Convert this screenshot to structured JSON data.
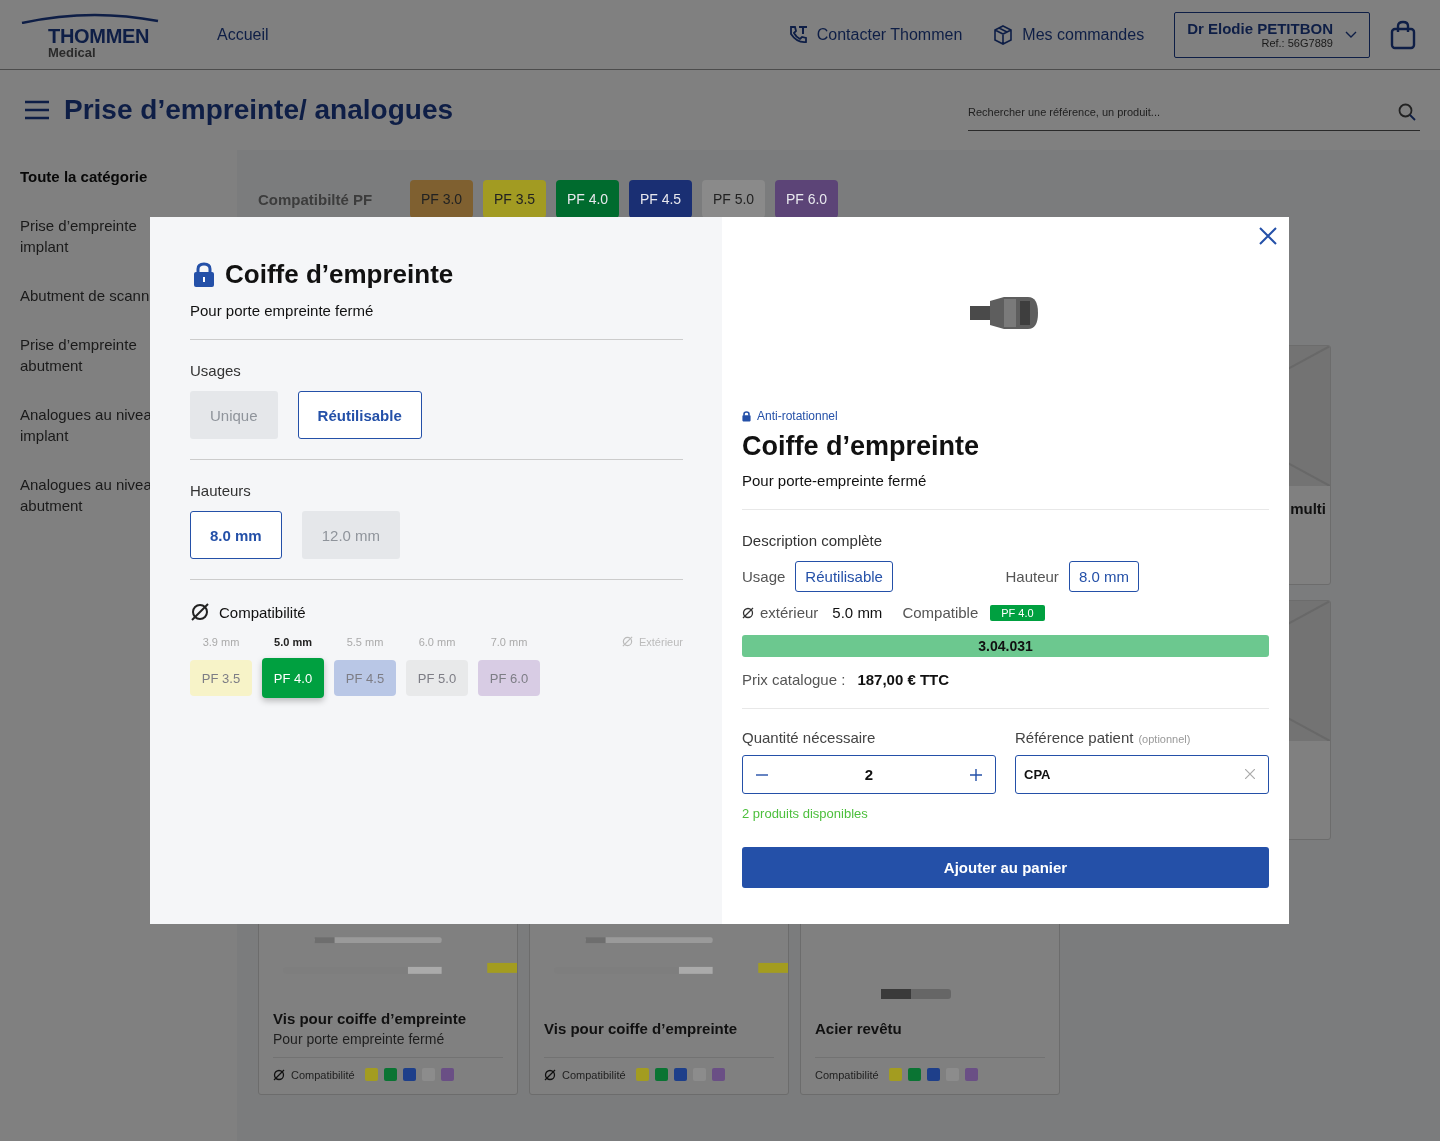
{
  "header": {
    "logo": {
      "name": "THOMMEN",
      "sub": "Medical"
    },
    "nav": [
      "Accueil"
    ],
    "actions": [
      {
        "kind": "phone",
        "label": "Contacter Thommen"
      },
      {
        "kind": "box",
        "label": "Mes commandes"
      }
    ],
    "user": {
      "name": "Dr Elodie PETITBON",
      "ref": "Ref.: 56G7889"
    }
  },
  "page_title": "Prise d’empreinte/ analogues",
  "search": {
    "placeholder": "Rechercher une référence, un produit..."
  },
  "sidebar": {
    "items": [
      {
        "label": "Toute la catégorie",
        "selected": true
      },
      {
        "label": "Prise d’empreinte\nimplant",
        "selected": false
      },
      {
        "label": "Abutment de scann",
        "selected": false
      },
      {
        "label": "Prise d’empreinte\nabutment",
        "selected": false
      },
      {
        "label": "Analogues au nivea\nimplant",
        "selected": false
      },
      {
        "label": "Analogues au nivea\nabutment",
        "selected": false
      }
    ]
  },
  "filter": {
    "label": "Compatibilté PF",
    "chips": [
      {
        "label": "PF 3.0",
        "color": "#7f6030",
        "dark_text": true
      },
      {
        "label": "PF 3.5",
        "color": "#a29b22",
        "dark_text": true
      },
      {
        "label": "PF 4.0",
        "color": "#006b2e",
        "dark_text": false
      },
      {
        "label": "PF 4.5",
        "color": "#1a2f73",
        "dark_text": false
      },
      {
        "label": "PF 5.0",
        "color": "#8a8a8a",
        "dark_text": true
      },
      {
        "label": "PF 6.0",
        "color": "#5c4477",
        "dark_text": false
      }
    ]
  },
  "side_cards": [
    {
      "kind": "titled",
      "title": "multi"
    },
    {
      "kind": "picture"
    }
  ],
  "products": [
    {
      "title": "Vis pour coiffe d’empreinte",
      "subtitle": "Pour porte empreinte fermé",
      "diameter_icon": true,
      "compat_label": "Compatibilité",
      "swatches": [
        {
          "color": "#a39c20"
        },
        {
          "color": "#0a7433"
        },
        {
          "color": "#1e3f8a"
        },
        {
          "color": "#8c8c8c"
        },
        {
          "color": "#6a4f85"
        }
      ]
    },
    {
      "title": "Vis pour coiffe d’empreinte",
      "diameter_icon": true,
      "compat_label": "Compatibilité",
      "swatches": [
        {
          "color": "#a39c20"
        },
        {
          "color": "#0a7433"
        },
        {
          "color": "#1e3f8a"
        },
        {
          "color": "#8c8c8c"
        },
        {
          "color": "#6a4f85"
        }
      ]
    },
    {
      "title": "Acier revêtu",
      "diameter_icon": false,
      "compat_label": "Compatibilité",
      "swatches": [
        {
          "color": "#a39c20"
        },
        {
          "color": "#0a7433"
        },
        {
          "color": "#1e3f8a"
        },
        {
          "color": "#8c8c8c"
        },
        {
          "color": "#6a4f85"
        }
      ]
    }
  ],
  "modal": {
    "left": {
      "title": "Coiffe d’empreinte",
      "subtitle": "Pour porte empreinte fermé",
      "groups": [
        {
          "label": "Usages",
          "options": [
            {
              "label": "Unique",
              "selected": false,
              "disabled": true
            },
            {
              "label": "Réutilisable",
              "selected": true,
              "disabled": false
            }
          ]
        },
        {
          "label": "Hauteurs",
          "options": [
            {
              "label": "8.0 mm",
              "selected": true,
              "disabled": false
            },
            {
              "label": "12.0 mm",
              "selected": false,
              "disabled": true
            }
          ]
        }
      ],
      "compat": {
        "label": "Compatibilité",
        "outer_label": "Extérieur",
        "options": [
          {
            "size": "3.9 mm",
            "label": "PF 3.5",
            "color": "#f7f3c8",
            "selected": false
          },
          {
            "size": "5.0 mm",
            "label": "PF 4.0",
            "color": "#00a040",
            "selected": true
          },
          {
            "size": "5.5 mm",
            "label": "PF 4.5",
            "color": "#b9c7e6",
            "selected": false
          },
          {
            "size": "6.0 mm",
            "label": "PF 5.0",
            "color": "#e8e9ea",
            "selected": false
          },
          {
            "size": "7.0 mm",
            "label": "PF 6.0",
            "color": "#d8cce4",
            "selected": false
          }
        ]
      }
    },
    "right": {
      "tag": "Anti-rotationnel",
      "title": "Coiffe d’empreinte",
      "subtitle": "Pour porte-empreinte fermé",
      "description_label": "Description complète",
      "usage_label": "Usage",
      "usage_value": "Réutilisable",
      "height_label": "Hauteur",
      "height_value": "8.0 mm",
      "outer_label": "extérieur",
      "outer_value": "5.0 mm",
      "compatible_label": "Compatible",
      "compatible_badge": "PF 4.0",
      "reference": "3.04.031",
      "price_label": "Prix catalogue :",
      "price": "187,00 € TTC",
      "quantity": {
        "label": "Quantité nécessaire",
        "value": "2"
      },
      "patient_ref": {
        "label": "Référence patient",
        "hint": "(optionnel)",
        "value": "CPA"
      },
      "availability": "2 produits disponibles",
      "add_button": "Ajouter au panier"
    }
  }
}
